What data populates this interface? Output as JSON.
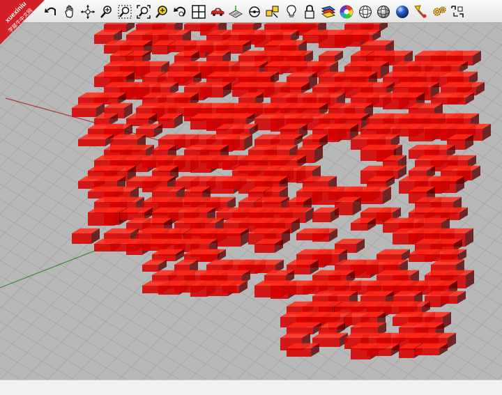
{
  "watermark": {
    "site": "xuexiniu",
    "site_cn": "学犀牛中文网"
  },
  "toolbar": {
    "tools": [
      {
        "name": "undo-icon"
      },
      {
        "name": "pan-hand-icon"
      },
      {
        "name": "rotate-view-icon"
      },
      {
        "name": "zoom-dynamic-icon"
      },
      {
        "name": "zoom-window-icon"
      },
      {
        "name": "zoom-extents-icon"
      },
      {
        "name": "zoom-selected-icon"
      },
      {
        "name": "undo-view-icon"
      },
      {
        "name": "four-viewports-icon"
      },
      {
        "name": "car-icon"
      },
      {
        "name": "grid-plane-icon"
      },
      {
        "name": "snap-target-icon"
      },
      {
        "name": "select-objects-icon"
      },
      {
        "name": "light-bulb-icon"
      },
      {
        "name": "lock-icon"
      },
      {
        "name": "layer-icon"
      },
      {
        "name": "color-wheel-icon"
      },
      {
        "name": "wireframe-sphere-icon"
      },
      {
        "name": "shaded-sphere-icon"
      },
      {
        "name": "render-sphere-icon"
      },
      {
        "name": "paint-brush-icon"
      },
      {
        "name": "gear-options-icon"
      },
      {
        "name": "dimension-icon"
      }
    ]
  },
  "viewport": {
    "background_color": "#b8b8b8",
    "grid_color": "#a4a4a4",
    "x_axis_color": "#b33a3a",
    "y_axis_color": "#3a8a3a",
    "object_color": "#d50000",
    "object_shadow_color": "#5a0000"
  },
  "colors": {
    "watermark_red": "#d41f26",
    "toolbar_background": "#ececec"
  }
}
